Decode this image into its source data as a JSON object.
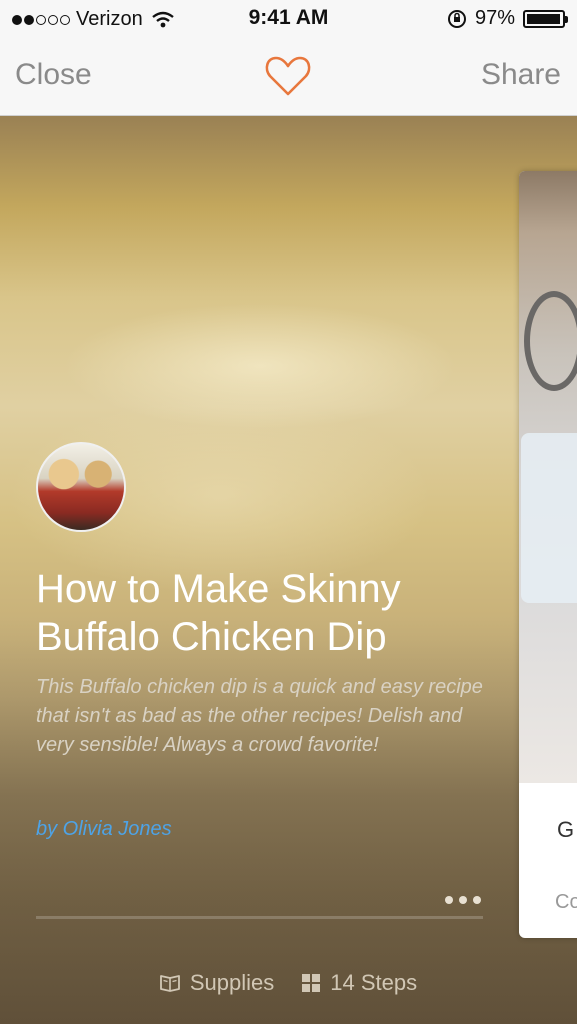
{
  "status_bar": {
    "carrier": "Verizon",
    "time": "9:41 AM",
    "battery": "97%"
  },
  "nav": {
    "close_label": "Close",
    "share_label": "Share",
    "favorite_icon": "heart-icon",
    "accent_color": "#e8773d"
  },
  "project": {
    "title": "How to Make Skinny Buffalo Chicken Dip",
    "description": "This Buffalo chicken dip is a quick and easy recipe that isn't as bad as the other recipes! Delish and very sensible! Always a crowd favorite!",
    "author": "by Olivia Jones",
    "supplies_label": "Supplies",
    "steps_label": "14 Steps"
  },
  "next_card": {
    "title_fragment": "G",
    "subtitle_fragment": "Co"
  }
}
